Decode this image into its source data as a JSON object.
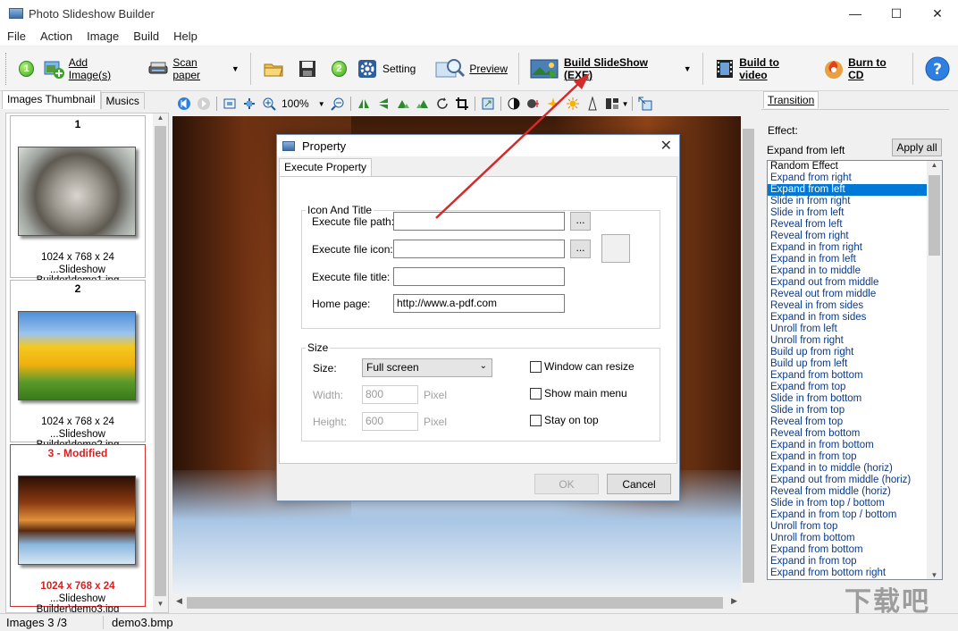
{
  "window": {
    "title": "Photo Slideshow Builder",
    "minimize": "—",
    "maximize": "☐",
    "close": "✕"
  },
  "menu": [
    "File",
    "Action",
    "Image",
    "Build",
    "Help"
  ],
  "toolbar": {
    "step1": "1",
    "add_images": "Add Image(s)",
    "scan_paper": "Scan paper",
    "step2": "2",
    "setting": "Setting",
    "preview": "Preview",
    "build_exe": "Build SlideShow (EXE)",
    "build_video": "Build to video",
    "burn_cd": "Burn to CD"
  },
  "left_panel": {
    "tabs": [
      "Images Thumbnail",
      "Musics"
    ],
    "thumbnails": [
      {
        "number": "1",
        "size": "1024 x 768 x 24",
        "path": "...Slideshow Builder\\demo1.jpg"
      },
      {
        "number": "2",
        "size": "1024 x 768 x 24",
        "path": "...Slideshow Builder\\demo2.jpg"
      },
      {
        "number": "3 - Modified",
        "size": "1024 x 768 x 24",
        "path": "...Slideshow Builder\\demo3.jpg"
      }
    ]
  },
  "image_toolbar": {
    "zoom": "100%"
  },
  "right_panel": {
    "tab": "Transition",
    "effect_label": "Effect:",
    "effect_value": "Expand from left",
    "apply_all": "Apply all",
    "effects": [
      "Random Effect",
      "Expand from right",
      "Expand from left",
      "Slide in from right",
      "Slide in from left",
      "Reveal from left",
      "Reveal from right",
      "Expand in from right",
      "Expand in from left",
      "Expand in to middle",
      "Expand out from middle",
      "Reveal out from middle",
      "Reveal in from sides",
      "Expand in from sides",
      "Unroll from left",
      "Unroll from right",
      "Build up from right",
      "Build up from left",
      "Expand from bottom",
      "Expand from top",
      "Slide in from bottom",
      "Slide in from top",
      "Reveal from top",
      "Reveal from bottom",
      "Expand in from bottom",
      "Expand in from top",
      "Expand in to middle (horiz)",
      "Expand out from middle (horiz)",
      "Reveal from middle (horiz)",
      "Slide in from top / bottom",
      "Expand in from top / bottom",
      "Unroll from top",
      "Unroll from bottom",
      "Expand from bottom",
      "Expand in from top",
      "Expand from bottom right"
    ],
    "selected_index": 2
  },
  "statusbar": {
    "images": "Images 3 /3",
    "file": "demo3.bmp"
  },
  "dialog": {
    "title": "Property",
    "tab": "Execute Property",
    "group1": "Icon And Title",
    "exec_path_label": "Execute file path:",
    "exec_path_value": "",
    "exec_icon_label": "Execute file icon:",
    "exec_icon_value": "",
    "exec_title_label": "Execute file title:",
    "exec_title_value": "",
    "home_label": "Home page:",
    "home_value": "http://www.a-pdf.com",
    "browse": "...",
    "group2": "Size",
    "size_label": "Size:",
    "size_value": "Full screen",
    "width_label": "Width:",
    "width_value": "800",
    "height_label": "Height:",
    "height_value": "600",
    "pixel": "Pixel",
    "resize": "Window can resize",
    "main_menu": "Show main menu",
    "on_top": "Stay on top",
    "ok": "OK",
    "cancel": "Cancel"
  },
  "colors": {
    "selection": "#0078d7",
    "modified": "#d62020",
    "arrow": "#d42a2a"
  }
}
